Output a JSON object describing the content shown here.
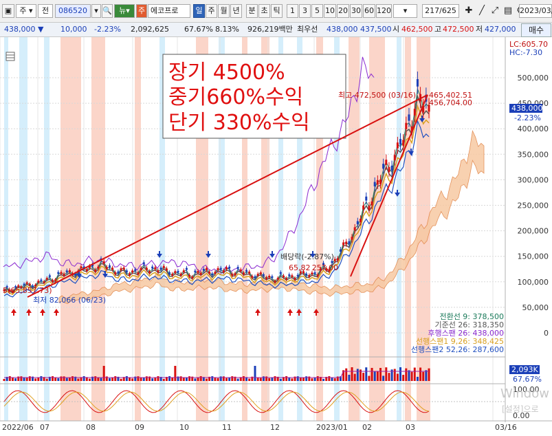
{
  "toolbar": {
    "period_menu": "주",
    "period_menu2": "전",
    "code": "086520",
    "news_btn": "뉴",
    "stock_tag": "주",
    "stock_name": "에코프로",
    "intervals": [
      "일",
      "주",
      "월",
      "년",
      "분",
      "초",
      "틱"
    ],
    "selected_interval": "일",
    "counts": [
      "1",
      "3",
      "5",
      "10",
      "20",
      "30",
      "60",
      "120"
    ],
    "page_counter": "217/625",
    "date": "2023/03/"
  },
  "quote": {
    "price": "438,000",
    "change": "10,000",
    "change_pct": "-2.23%",
    "volume": "2,092,625",
    "vol_pct": "67.67%",
    "turnover_pct": "8.13%",
    "amount": "926,219백만",
    "best_label": "최우선",
    "ask": "438,000",
    "bid": "437,500",
    "open_label": "시",
    "open": "462,500",
    "high_label": "고",
    "high": "472,500",
    "low_label": "저",
    "low": "427,000",
    "buy_button": "매수"
  },
  "chart": {
    "annotation_lines": [
      "장기  4500%",
      "중기660%수익",
      "단기  330%수익"
    ],
    "high_note": "최고 472,500 (03/16)",
    "right_high_note1": "465,402.51",
    "right_high_note2": "456,704.00",
    "low_note": "최저 82,066 (06/23)",
    "dividend_note": "배당락(-2.87%)",
    "mid_note": "65,82 257,00",
    "left_note": "5(65,857.73)",
    "lc": "LC:605.70",
    "hc": "HC:-7.30",
    "y_ticks": [
      "500,000",
      "450,000",
      "400,000",
      "350,000",
      "300,000",
      "250,000",
      "200,000",
      "150,000",
      "100,000",
      "50,000",
      "0"
    ],
    "price_tag": "438,000",
    "price_tag_pct": "-2.23%",
    "ichimoku": [
      "전환선 9: 378,500",
      "기준선 26: 318,350",
      "후행스팬 26: 438,000",
      "선행스팬1 9,26: 348,425",
      "선행스팬2 52,26: 287,600"
    ],
    "volume_tag": "2,093K",
    "volume_tag_pct": "67.67%",
    "osc_top": "100.00",
    "osc_bottom": "0.00",
    "watermark1": "Window",
    "watermark2": "[설정]으로",
    "x_labels": [
      "2022/06",
      "07",
      "08",
      "09",
      "10",
      "11",
      "12",
      "2023/01",
      "02",
      "03",
      "03/16"
    ]
  },
  "chart_data": {
    "type": "candlestick",
    "title": "",
    "ylim": [
      0,
      520000
    ],
    "series": [
      {
        "name": "전환선 9",
        "last": 378500
      },
      {
        "name": "기준선 26",
        "last": 318350
      },
      {
        "name": "후행스팬 26",
        "last": 438000
      },
      {
        "name": "선행스팬1 9,26",
        "last": 348425
      },
      {
        "name": "선행스팬2 52,26",
        "last": 287600
      }
    ],
    "close_approx": [
      82000,
      90000,
      95000,
      100000,
      110000,
      118000,
      122000,
      130000,
      135000,
      122000,
      120000,
      125000,
      128000,
      122000,
      118000,
      117000,
      120000,
      122000,
      124000,
      120000,
      115000,
      110000,
      108000,
      112000,
      115000,
      118000,
      130000,
      160000,
      200000,
      250000,
      300000,
      340000,
      380000,
      465000,
      438000
    ]
  },
  "colors": {
    "pink_band": "#fbd5c9",
    "cyan_band": "#d5eefb",
    "price_line": "#d81010",
    "accent_blue": "#1b3fb8"
  }
}
